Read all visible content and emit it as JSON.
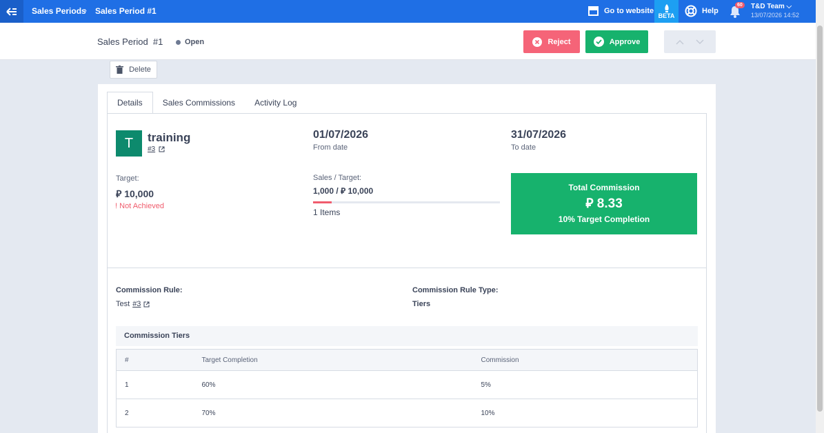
{
  "topbar": {
    "breadcrumbs": [
      "Sales Periods",
      "Sales Period #1"
    ],
    "goto_website": "Go to website",
    "beta": "BETA",
    "help": "Help",
    "notifications": "60",
    "user_name": "T&D Team",
    "timestamp": "13/07/2026 14:52"
  },
  "header": {
    "title": "Sales Period  #1",
    "status": "Open",
    "reject_label": "Reject",
    "approve_label": "Approve"
  },
  "toolbar": {
    "delete_label": "Delete"
  },
  "tabs": [
    "Details",
    "Sales Commissions",
    "Activity Log"
  ],
  "details": {
    "avatar_letter": "T",
    "employee_name": "training",
    "employee_ref": "#3",
    "from_date": "01/07/2026",
    "from_label": "From date",
    "to_date": "31/07/2026",
    "to_label": "To date",
    "target_label": "Target:",
    "target_value": "⃁ 10,000",
    "target_status": "Not Achieved",
    "sales_target_label": "Sales / Target:",
    "sales_target_value": "1,000 / ⃁ 10,000",
    "progress_fraction": 0.1,
    "items_count": "1 Items",
    "total_commission_label": "Total Commission",
    "total_commission_value": "⃁ 8.33",
    "completion_label": "10% Target Completion"
  },
  "rule": {
    "label": "Commission Rule:",
    "name": "Test",
    "ref": "#3",
    "type_label": "Commission Rule Type:",
    "type_value": "Tiers"
  },
  "tiers": {
    "title": "Commission Tiers",
    "headers": [
      "#",
      "Target Completion",
      "Commission"
    ],
    "rows": [
      [
        "1",
        "60%",
        "5%"
      ],
      [
        "2",
        "70%",
        "10%"
      ]
    ]
  },
  "colors": {
    "primary": "#1f6fe5",
    "reject": "#f56478",
    "approve": "#17b26d",
    "avatar": "#0d8a6d"
  }
}
